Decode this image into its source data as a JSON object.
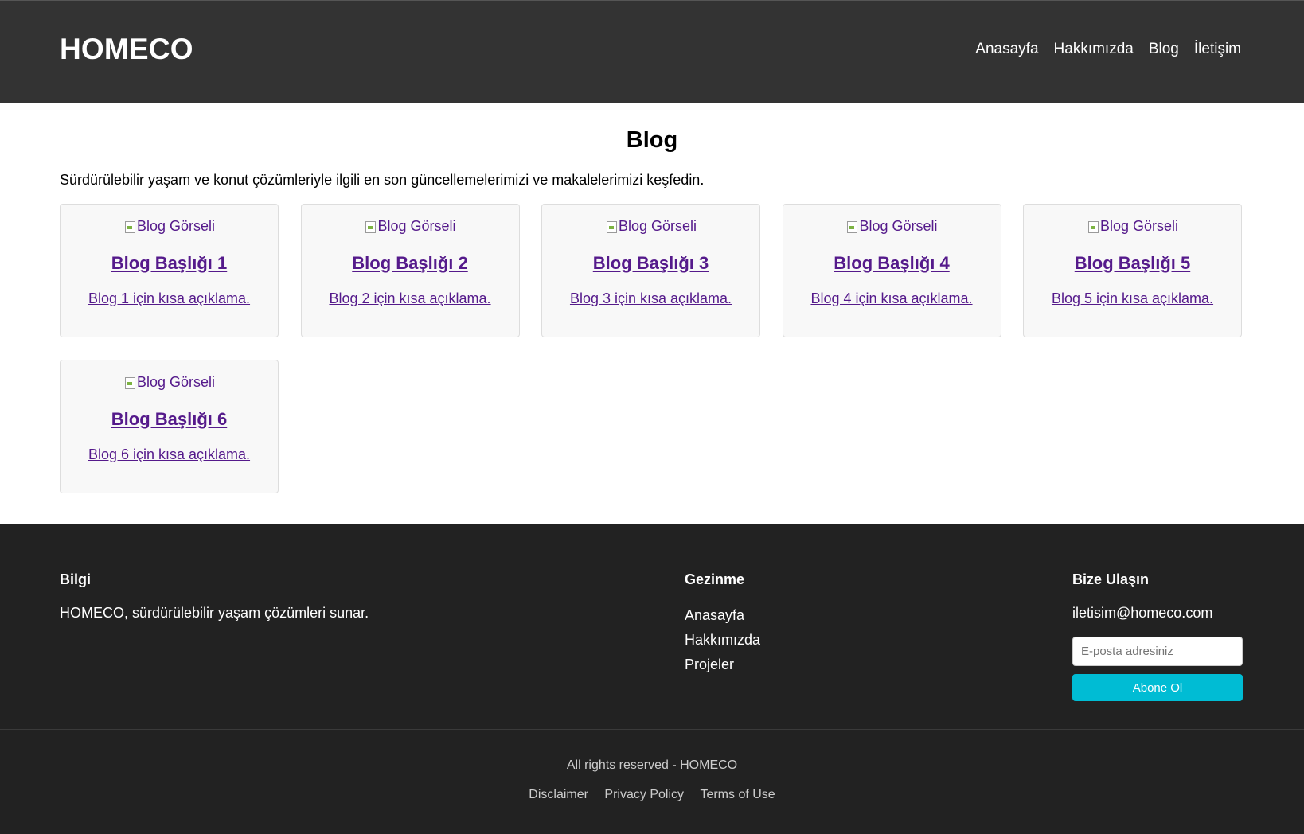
{
  "header": {
    "logo": "HOMECO",
    "nav": [
      "Anasayfa",
      "Hakkımızda",
      "Blog",
      "İletişim"
    ]
  },
  "main": {
    "title": "Blog",
    "intro": "Sürdürülebilir yaşam ve konut çözümleriyle ilgili en son güncellemelerimizi ve makalelerimizi keşfedin.",
    "posts": [
      {
        "image_alt": "Blog Görseli",
        "title": "Blog Başlığı 1",
        "description": "Blog 1 için kısa açıklama."
      },
      {
        "image_alt": "Blog Görseli",
        "title": "Blog Başlığı 2",
        "description": "Blog 2 için kısa açıklama."
      },
      {
        "image_alt": "Blog Görseli",
        "title": "Blog Başlığı 3",
        "description": "Blog 3 için kısa açıklama."
      },
      {
        "image_alt": "Blog Görseli",
        "title": "Blog Başlığı 4",
        "description": "Blog 4 için kısa açıklama."
      },
      {
        "image_alt": "Blog Görseli",
        "title": "Blog Başlığı 5",
        "description": "Blog 5 için kısa açıklama."
      },
      {
        "image_alt": "Blog Görseli",
        "title": "Blog Başlığı 6",
        "description": "Blog 6 için kısa açıklama."
      }
    ]
  },
  "footer": {
    "info": {
      "heading": "Bilgi",
      "text": "HOMECO, sürdürülebilir yaşam çözümleri sunar."
    },
    "navigation": {
      "heading": "Gezinme",
      "links": [
        "Anasayfa",
        "Hakkımızda",
        "Projeler"
      ]
    },
    "contact": {
      "heading": "Bize Ulaşın",
      "email": "iletisim@homeco.com",
      "input_placeholder": "E-posta adresiniz",
      "subscribe_label": "Abone Ol"
    },
    "copyright": "All rights reserved - HOMECO",
    "legal_links": [
      "Disclaimer",
      "Privacy Policy",
      "Terms of Use"
    ]
  },
  "colors": {
    "header_bg": "#333333",
    "footer_bg": "#222222",
    "link_visited": "#551a8b",
    "accent": "#00bcd4"
  }
}
